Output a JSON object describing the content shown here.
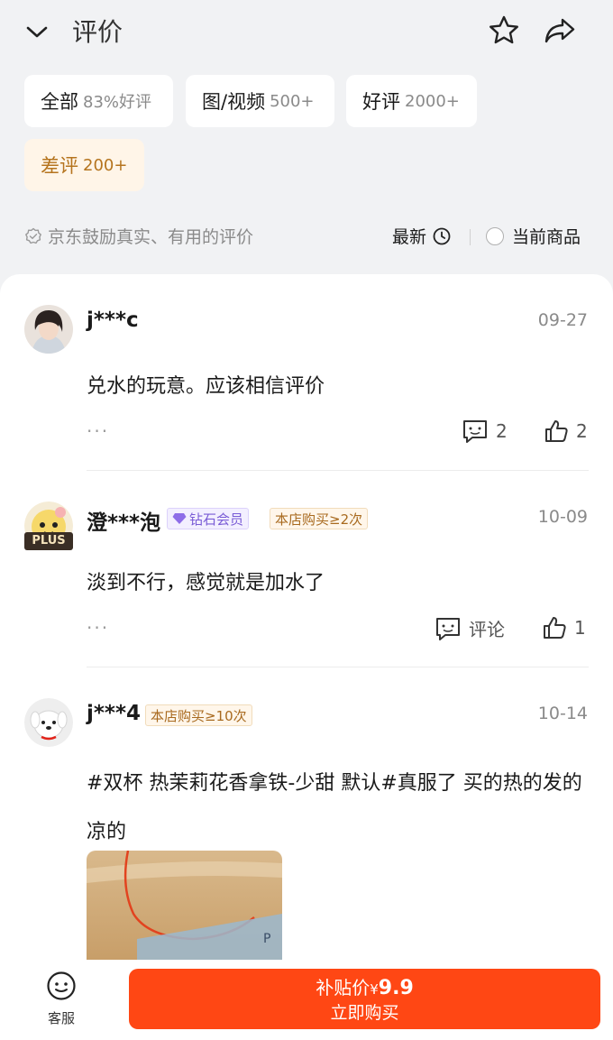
{
  "header": {
    "title": "评价"
  },
  "filters": [
    {
      "label": "全部",
      "sub": "83%好评"
    },
    {
      "label": "图/视频",
      "sub": "500+"
    },
    {
      "label": "好评",
      "sub": "2000+"
    },
    {
      "label": "差评",
      "sub": "200+"
    }
  ],
  "infobar": {
    "encourage": "京东鼓励真实、有用的评价",
    "sort": "最新",
    "current": "当前商品"
  },
  "reviews": [
    {
      "user": "j***c",
      "date": "09-27",
      "content": "兑水的玩意。应该相信评价",
      "comments": "2",
      "likes": "2"
    },
    {
      "user": "澄***泡",
      "badge_diamond": "钻石会员",
      "badge_repeat": "本店购买≥2次",
      "plus": "PLUS",
      "date": "10-09",
      "content": "淡到不行，感觉就是加水了",
      "comments": "评论",
      "likes": "1"
    },
    {
      "user": "j***4",
      "badge_repeat": "本店购买≥10次",
      "date": "10-14",
      "content": "#双杯 热茉莉花香拿铁-少甜 默认#真服了  买的热的发的凉的"
    }
  ],
  "bottom": {
    "service": "客服",
    "buy_label": "补贴价",
    "currency": "¥",
    "price": "9.9",
    "buy_now": "立即购买"
  },
  "colors": {
    "accent": "#ff4714",
    "bad_chip_bg": "#fff5e8",
    "bad_chip_text": "#b5741e"
  }
}
